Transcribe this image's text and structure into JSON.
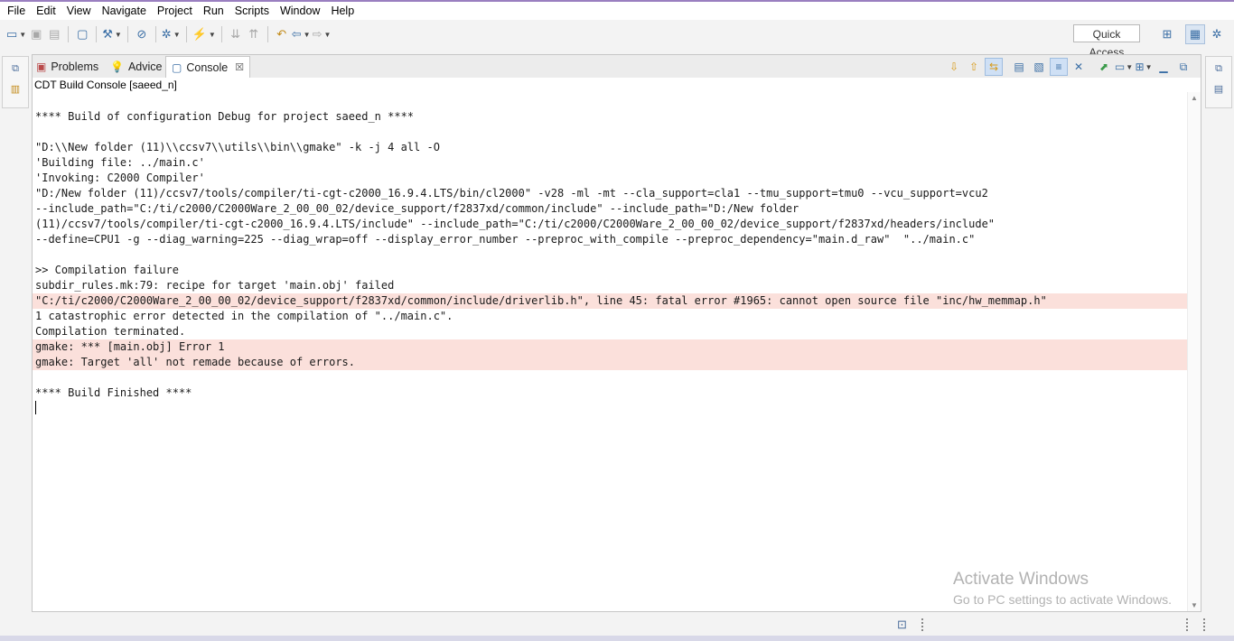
{
  "menu": [
    "File",
    "Edit",
    "View",
    "Navigate",
    "Project",
    "Run",
    "Scripts",
    "Window",
    "Help"
  ],
  "toolbar": {
    "quick_access": "Quick Access"
  },
  "tabs": [
    {
      "label": "Problems",
      "icon": "problems-icon"
    },
    {
      "label": "Advice",
      "icon": "lightbulb-icon"
    },
    {
      "label": "Console",
      "icon": "console-icon",
      "active": true,
      "close": "☒"
    }
  ],
  "console": {
    "title": "CDT Build Console [saeed_n]",
    "lines": [
      {
        "text": "**** Build of configuration Debug for project saeed_n ****",
        "error": false
      },
      {
        "text": "",
        "error": false
      },
      {
        "text": "\"D:\\\\New folder (11)\\\\ccsv7\\\\utils\\\\bin\\\\gmake\" -k -j 4 all -O",
        "error": false
      },
      {
        "text": "'Building file: ../main.c'",
        "error": false
      },
      {
        "text": "'Invoking: C2000 Compiler'",
        "error": false
      },
      {
        "text": "\"D:/New folder (11)/ccsv7/tools/compiler/ti-cgt-c2000_16.9.4.LTS/bin/cl2000\" -v28 -ml -mt --cla_support=cla1 --tmu_support=tmu0 --vcu_support=vcu2",
        "error": false
      },
      {
        "text": "--include_path=\"C:/ti/c2000/C2000Ware_2_00_00_02/device_support/f2837xd/common/include\" --include_path=\"D:/New folder",
        "error": false
      },
      {
        "text": "(11)/ccsv7/tools/compiler/ti-cgt-c2000_16.9.4.LTS/include\" --include_path=\"C:/ti/c2000/C2000Ware_2_00_00_02/device_support/f2837xd/headers/include\"",
        "error": false
      },
      {
        "text": "--define=CPU1 -g --diag_warning=225 --diag_wrap=off --display_error_number --preproc_with_compile --preproc_dependency=\"main.d_raw\"  \"../main.c\"",
        "error": false
      },
      {
        "text": "",
        "error": false
      },
      {
        "text": ">> Compilation failure",
        "error": false
      },
      {
        "text": "subdir_rules.mk:79: recipe for target 'main.obj' failed",
        "error": false
      },
      {
        "text": "\"C:/ti/c2000/C2000Ware_2_00_00_02/device_support/f2837xd/common/include/driverlib.h\", line 45: fatal error #1965: cannot open source file \"inc/hw_memmap.h\"",
        "error": true
      },
      {
        "text": "1 catastrophic error detected in the compilation of \"../main.c\".",
        "error": false
      },
      {
        "text": "Compilation terminated.",
        "error": false
      },
      {
        "text": "gmake: *** [main.obj] Error 1",
        "error": true
      },
      {
        "text": "gmake: Target 'all' not remade because of errors.",
        "error": true
      },
      {
        "text": "",
        "error": false
      },
      {
        "text": "**** Build Finished ****",
        "error": false
      }
    ]
  },
  "watermark": {
    "line1": "Activate Windows",
    "line2": "Go to PC settings to activate Windows."
  },
  "colors": {
    "error_background": "#fbe0db",
    "accent": "#3a6ea5"
  }
}
